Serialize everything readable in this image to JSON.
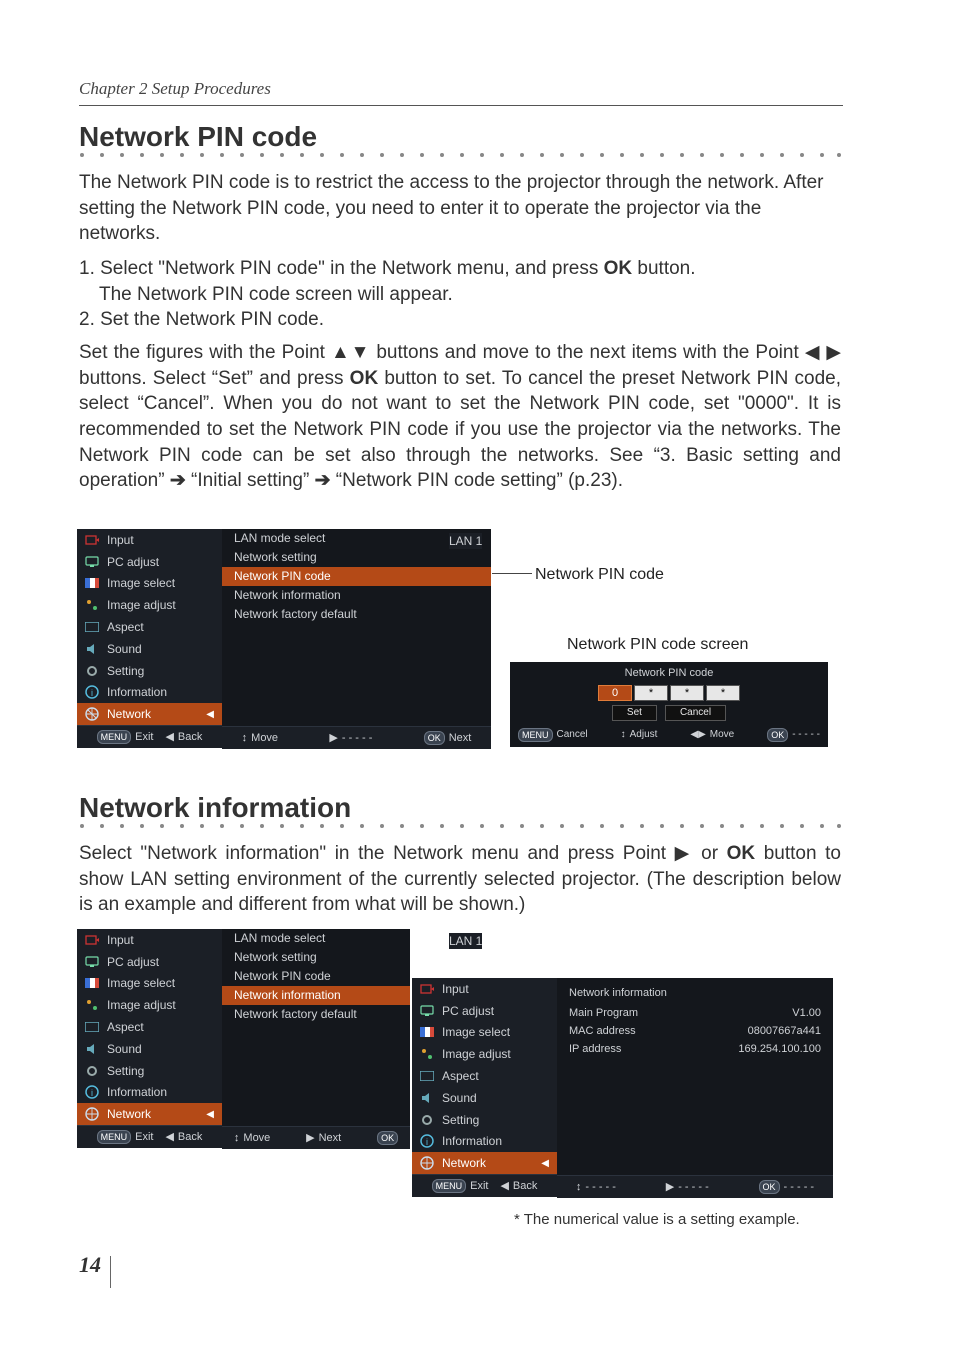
{
  "header": {
    "chapter": "Chapter 2 Setup Procedures"
  },
  "section1": {
    "title": "Network PIN code",
    "para1": "The Network PIN code is to restrict the access to the projector through the network. After setting the Network PIN code, you need to enter it to operate the projector via the networks.",
    "step1a": "1. Select \"Network PIN code\" in the Network menu, and press ",
    "step1_ok": "OK",
    "step1b": " button.",
    "step1c": "The Network PIN code screen will appear.",
    "step2": "2. Set the Network PIN code.",
    "set_a": "Set the figures with the Point ",
    "set_b": " buttons and move to the next items with the Point ",
    "set_c": " buttons. Select “Set” and press ",
    "set_ok": "OK",
    "set_d": " button to set. To cancel the preset Network PIN code, select “Cancel”. When you do not want to set the Network PIN code, set \"0000\".",
    "rec1": "It is recommended to set the Network PIN code if you use the projector via the networks. The Network PIN code can be set also through the networks.  See “3. Basic setting and operation” ",
    "rec2": " “Initial setting” ",
    "rec3": " “Network PIN code setting” (p.23).",
    "callout_pin": "Network PIN code",
    "callout_scr": "Network PIN code screen"
  },
  "section2": {
    "title": "Network information",
    "para_a": "Select \"Network information\" in the Network menu and press Point ",
    "para_or": " or ",
    "para_ok": "OK",
    "para_b": " button to show LAN setting environment of the currently selected projector. (The description below is an example and different from what will be shown.)"
  },
  "osd": {
    "side": {
      "input": "Input",
      "pc": "PC adjust",
      "imgsel": "Image select",
      "imgadj": "Image adjust",
      "aspect": "Aspect",
      "sound": "Sound",
      "setting": "Setting",
      "info": "Information",
      "network": "Network"
    },
    "menu": {
      "lanmode": "LAN mode select",
      "netset": "Network setting",
      "pin": "Network PIN code",
      "ninfo": "Network information",
      "factory": "Network factory default",
      "lanval": "LAN 1"
    },
    "foot": {
      "exit": "Exit",
      "back": "Back",
      "move": "Move",
      "dash": "- - - - -",
      "next": "Next",
      "menu": "MENU",
      "ok": "OK",
      "cancel": "Cancel",
      "adjust": "Adjust"
    }
  },
  "pin": {
    "title": "Network PIN code",
    "digits": [
      "0",
      "*",
      "*",
      "*"
    ],
    "set": "Set",
    "cancel": "Cancel"
  },
  "netinfo": {
    "title": "Network information",
    "main": "Main Program",
    "mac": "MAC address",
    "ip": "IP address",
    "v_main": "V1.00",
    "v_mac": "08007667a441",
    "v_ip": "169.254.100.100"
  },
  "footnote": "* The numerical value is a setting example.",
  "pagenum": "14",
  "chart_data": null
}
